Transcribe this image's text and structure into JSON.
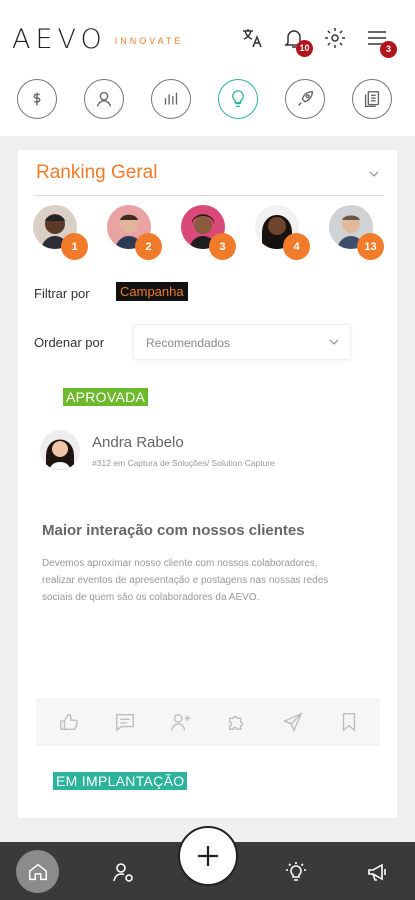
{
  "header": {
    "logo_text": "AEVO",
    "logo_sub": "INNOVATE",
    "notifications_count": "10",
    "menu_count": "3"
  },
  "categories": [
    {
      "name": "dollar-icon"
    },
    {
      "name": "user-icon"
    },
    {
      "name": "bar-chart-icon"
    },
    {
      "name": "lightbulb-icon"
    },
    {
      "name": "rocket-icon"
    },
    {
      "name": "documents-icon"
    }
  ],
  "ranking": {
    "title": "Ranking Geral",
    "users": [
      {
        "position": "1"
      },
      {
        "position": "2"
      },
      {
        "position": "3"
      },
      {
        "position": "4"
      },
      {
        "position": "13"
      }
    ]
  },
  "filter": {
    "label": "Filtrar por",
    "value": "Campanha"
  },
  "order": {
    "label": "Ordenar por",
    "value": "Recomendados"
  },
  "idea": {
    "status": "APROVADA",
    "author": "Andra Rabelo",
    "meta": "#312 em Captura de Soluções/ Solution Capture",
    "title": "Maior interação com nossos clientes",
    "description": "Devemos aproximar nosso cliente com nossos colaboradores, realizar eventos de apresentação e postagens nas nossas redes sociais de quem são os colaboradores da AEVO."
  },
  "next_idea": {
    "status": "EM IMPLANTAÇÃO"
  },
  "colors": {
    "accent": "#f07b2a",
    "approved": "#6cb92d",
    "implementing": "#2bb39b",
    "badge": "#b3141b",
    "nav_bg": "#3a3a3a"
  }
}
